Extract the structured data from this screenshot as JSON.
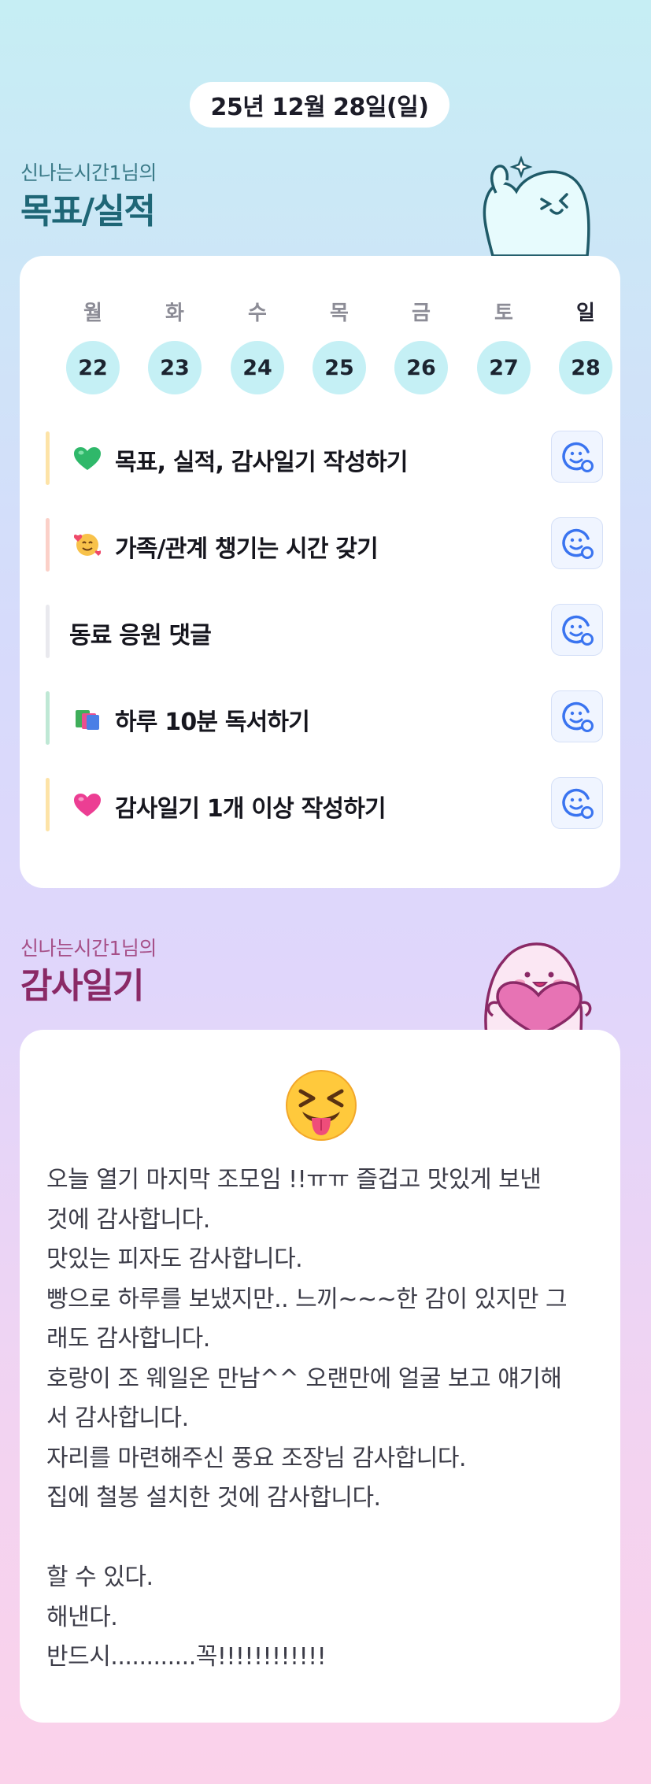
{
  "header": {
    "date": "25년 12월 28일(일)"
  },
  "goals_section": {
    "subtitle": "신나는시간1님의",
    "title": "목표/실적"
  },
  "week": {
    "weekdays": [
      "월",
      "화",
      "수",
      "목",
      "금",
      "토",
      "일"
    ],
    "days": [
      "22",
      "23",
      "24",
      "25",
      "26",
      "27",
      "28"
    ]
  },
  "goals": [
    {
      "label": "목표, 실적, 감사일기 작성하기",
      "icon": "green-heart-icon",
      "bar_color": "#fde3a7"
    },
    {
      "label": "가족/관계 챙기는 시간 갖기",
      "icon": "smiling-face-with-hearts-icon",
      "bar_color": "#fbd0c8"
    },
    {
      "label": "동료 응원 댓글",
      "icon": "",
      "bar_color": "#e9e9ee"
    },
    {
      "label": "하루 10분 독서하기",
      "icon": "books-icon",
      "bar_color": "#bfe8d5"
    },
    {
      "label": "감사일기 1개 이상 작성하기",
      "icon": "pink-heart-icon",
      "bar_color": "#fde3a7"
    }
  ],
  "gratitude_section": {
    "subtitle": "신나는시간1님의",
    "title": "감사일기"
  },
  "gratitude": {
    "mood_icon": "squinting-face-with-tongue-icon",
    "lines": [
      "오늘 열기 마지막 조모임 !!ㅠㅠ 즐겁고 맛있게 보낸",
      "것에 감사합니다.",
      "맛있는 피자도 감사합니다.",
      "빵으로 하루를 보냈지만.. 느끼~~~한 감이 있지만 그",
      "래도 감사합니다.",
      "호랑이 조 웨일온 만남^^ 오랜만에 얼굴 보고 얘기해",
      "서 감사합니다.",
      "자리를 마련해주신 풍요 조장님 감사합니다.",
      "집에 철봉 설치한 것에 감사합니다.",
      "",
      "할 수 있다.",
      "해낸다.",
      "반드시............꼭!!!!!!!!!!!!"
    ]
  },
  "colors": {
    "accent_teal": "#1e6676",
    "accent_magenta": "#8a2966",
    "day_circle": "#c5f0f5",
    "reaction_blue": "#3a74f0"
  }
}
